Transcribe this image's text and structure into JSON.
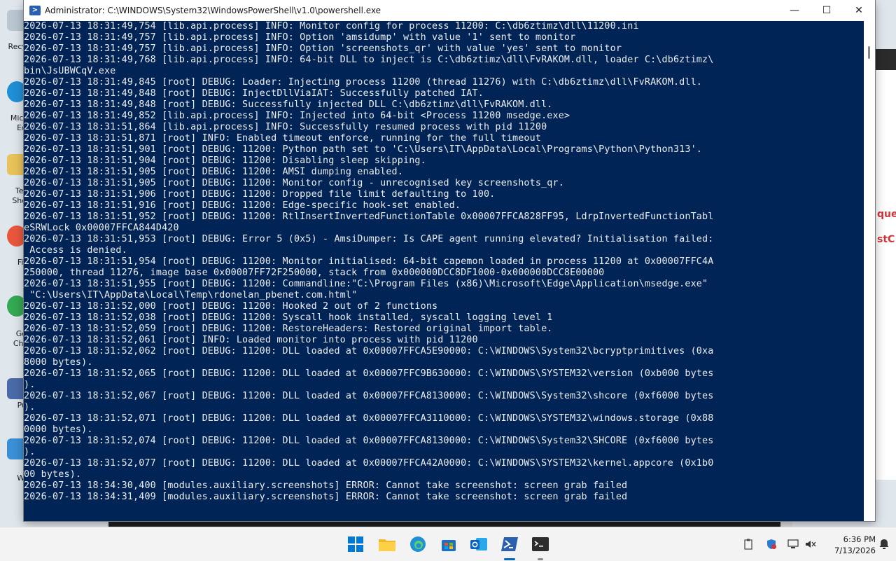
{
  "window": {
    "title": "Administrator: C:\\WINDOWS\\System32\\WindowsPowerShell\\v1.0\\powershell.exe",
    "minimize_glyph": "—",
    "maximize_glyph": "☐",
    "close_glyph": "✕"
  },
  "console_lines": [
    "2026-07-13 18:31:49,754 [lib.api.process] INFO: Monitor config for process 11200: C:\\db6ztimz\\dll\\11200.ini",
    "2026-07-13 18:31:49,757 [lib.api.process] INFO: Option 'amsidump' with value '1' sent to monitor",
    "2026-07-13 18:31:49,757 [lib.api.process] INFO: Option 'screenshots_qr' with value 'yes' sent to monitor",
    "2026-07-13 18:31:49,768 [lib.api.process] INFO: 64-bit DLL to inject is C:\\db6ztimz\\dll\\FvRAKOM.dll, loader C:\\db6ztimz\\",
    "bin\\JsUBWCqV.exe",
    "2026-07-13 18:31:49,845 [root] DEBUG: Loader: Injecting process 11200 (thread 11276) with C:\\db6ztimz\\dll\\FvRAKOM.dll.",
    "2026-07-13 18:31:49,848 [root] DEBUG: InjectDllViaIAT: Successfully patched IAT.",
    "2026-07-13 18:31:49,848 [root] DEBUG: Successfully injected DLL C:\\db6ztimz\\dll\\FvRAKOM.dll.",
    "2026-07-13 18:31:49,852 [lib.api.process] INFO: Injected into 64-bit <Process 11200 msedge.exe>",
    "2026-07-13 18:31:51,864 [lib.api.process] INFO: Successfully resumed process with pid 11200",
    "2026-07-13 18:31:51,871 [root] INFO: Enabled timeout enforce, running for the full timeout",
    "2026-07-13 18:31:51,901 [root] DEBUG: 11200: Python path set to 'C:\\Users\\IT\\AppData\\Local\\Programs\\Python\\Python313'.",
    "2026-07-13 18:31:51,904 [root] DEBUG: 11200: Disabling sleep skipping.",
    "2026-07-13 18:31:51,905 [root] DEBUG: 11200: AMSI dumping enabled.",
    "2026-07-13 18:31:51,905 [root] DEBUG: 11200: Monitor config - unrecognised key screenshots_qr.",
    "2026-07-13 18:31:51,906 [root] DEBUG: 11200: Dropped file limit defaulting to 100.",
    "2026-07-13 18:31:51,916 [root] DEBUG: 11200: Edge-specific hook-set enabled.",
    "2026-07-13 18:31:51,952 [root] DEBUG: 11200: RtlInsertInvertedFunctionTable 0x00007FFCA828FF95, LdrpInvertedFunctionTabl",
    "eSRWLock 0x00007FFCA844D420",
    "2026-07-13 18:31:51,953 [root] DEBUG: Error 5 (0x5) - AmsiDumper: Is CAPE agent running elevated? Initialisation failed:",
    " Access is denied.",
    "2026-07-13 18:31:51,954 [root] DEBUG: 11200: Monitor initialised: 64-bit capemon loaded in process 11200 at 0x00007FFC4A",
    "250000, thread 11276, image base 0x00007FF72F250000, stack from 0x000000DCC8DF1000-0x000000DCC8E00000",
    "2026-07-13 18:31:51,955 [root] DEBUG: 11200: Commandline:\"C:\\Program Files (x86)\\Microsoft\\Edge\\Application\\msedge.exe\"",
    " \"C:\\Users\\IT\\AppData\\Local\\Temp\\rdonelan_pbenet.com.html\"",
    "2026-07-13 18:31:52,000 [root] DEBUG: 11200: Hooked 2 out of 2 functions",
    "2026-07-13 18:31:52,038 [root] DEBUG: 11200: Syscall hook installed, syscall logging level 1",
    "2026-07-13 18:31:52,059 [root] DEBUG: 11200: RestoreHeaders: Restored original import table.",
    "2026-07-13 18:31:52,061 [root] INFO: Loaded monitor into process with pid 11200",
    "2026-07-13 18:31:52,062 [root] DEBUG: 11200: DLL loaded at 0x00007FFCA5E90000: C:\\WINDOWS\\System32\\bcryptprimitives (0xa",
    "8000 bytes).",
    "2026-07-13 18:31:52,065 [root] DEBUG: 11200: DLL loaded at 0x00007FFC9B630000: C:\\WINDOWS\\SYSTEM32\\version (0xb000 bytes",
    ").",
    "2026-07-13 18:31:52,067 [root] DEBUG: 11200: DLL loaded at 0x00007FFCA8130000: C:\\WINDOWS\\System32\\shcore (0xf6000 bytes",
    ").",
    "2026-07-13 18:31:52,071 [root] DEBUG: 11200: DLL loaded at 0x00007FFCA3110000: C:\\WINDOWS\\SYSTEM32\\windows.storage (0x88",
    "0000 bytes).",
    "2026-07-13 18:31:52,074 [root] DEBUG: 11200: DLL loaded at 0x00007FFCA8130000: C:\\WINDOWS\\System32\\SHCORE (0xf6000 bytes",
    ").",
    "2026-07-13 18:31:52,077 [root] DEBUG: 11200: DLL loaded at 0x00007FFCA42A0000: C:\\WINDOWS\\SYSTEM32\\kernel.appcore (0x1b0",
    "00 bytes).",
    "2026-07-13 18:34:30,400 [modules.auxiliary.screenshots] ERROR: Cannot take screenshot: screen grab failed",
    "2026-07-13 18:34:31,409 [modules.auxiliary.screenshots] ERROR: Cannot take screenshot: screen grab failed"
  ],
  "desktop_icons": [
    {
      "label": "Recy",
      "icon": "recycle-bin-icon"
    },
    {
      "label": "Micr",
      "icon": "edge-shortcut-icon"
    },
    {
      "label": "Ed",
      "icon": "edge-shortcut-icon"
    },
    {
      "label": "Ter",
      "icon": "terminal-shortcut-icon"
    },
    {
      "label": "Sho",
      "icon": "terminal-shortcut-icon"
    },
    {
      "label": "Fir",
      "icon": "firefox-shortcut-icon"
    },
    {
      "label": "Go",
      "icon": "chrome-shortcut-icon"
    },
    {
      "label": "Chr",
      "icon": "chrome-shortcut-icon"
    },
    {
      "label": "Pu",
      "icon": "putty-shortcut-icon"
    },
    {
      "label": "Wi",
      "icon": "windows-shortcut-icon"
    }
  ],
  "background_window_fragments": [
    "que",
    "stC"
  ],
  "taskbar": {
    "items": [
      "start-icon",
      "file-explorer-icon",
      "edge-icon",
      "store-icon",
      "outlook-icon",
      "powershell-icon",
      "terminal-icon"
    ]
  },
  "tray": {
    "time": "6:36 PM",
    "date": "7/13/2026"
  },
  "colors": {
    "console_bg": "#012456",
    "console_fg": "#eeedf0",
    "taskbar_bg": "#f3f3f3",
    "accent": "#0067c0"
  }
}
